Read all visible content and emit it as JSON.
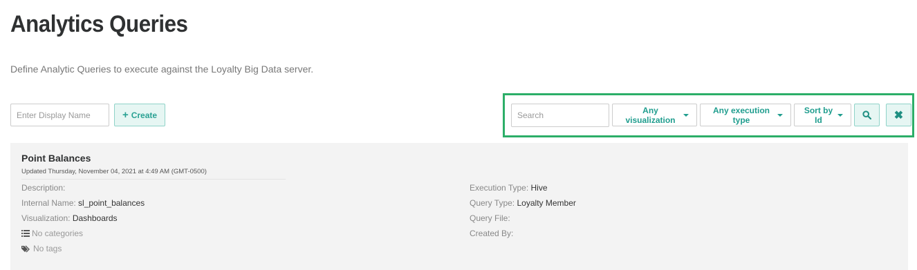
{
  "header": {
    "title": "Analytics Queries",
    "description": "Define Analytic Queries to execute against the Loyalty Big Data server."
  },
  "create": {
    "name_placeholder": "Enter Display Name",
    "create_label": "Create"
  },
  "filters": {
    "search_placeholder": "Search",
    "visualization_label": "Any visualization",
    "execution_type_label": "Any execution type",
    "sort_label": "Sort by Id",
    "highlight_color": "#2cae68"
  },
  "query": {
    "title": "Point Balances",
    "updated": "Updated Thursday, November 04, 2021 at 4:49 AM (GMT-0500)",
    "description_label": "Description:",
    "internal_name_label": "Internal Name:",
    "internal_name_value": "sl_point_balances",
    "visualization_label": "Visualization:",
    "visualization_value": "Dashboards",
    "categories": "No categories",
    "tags": "No tags",
    "execution_type_label": "Execution Type:",
    "execution_type_value": "Hive",
    "query_type_label": "Query Type:",
    "query_type_value": "Loyalty Member",
    "query_file_label": "Query File:",
    "created_by_label": "Created By:"
  },
  "colors": {
    "accent": "#1f9d8e",
    "button_bg": "#e6f6f3"
  }
}
